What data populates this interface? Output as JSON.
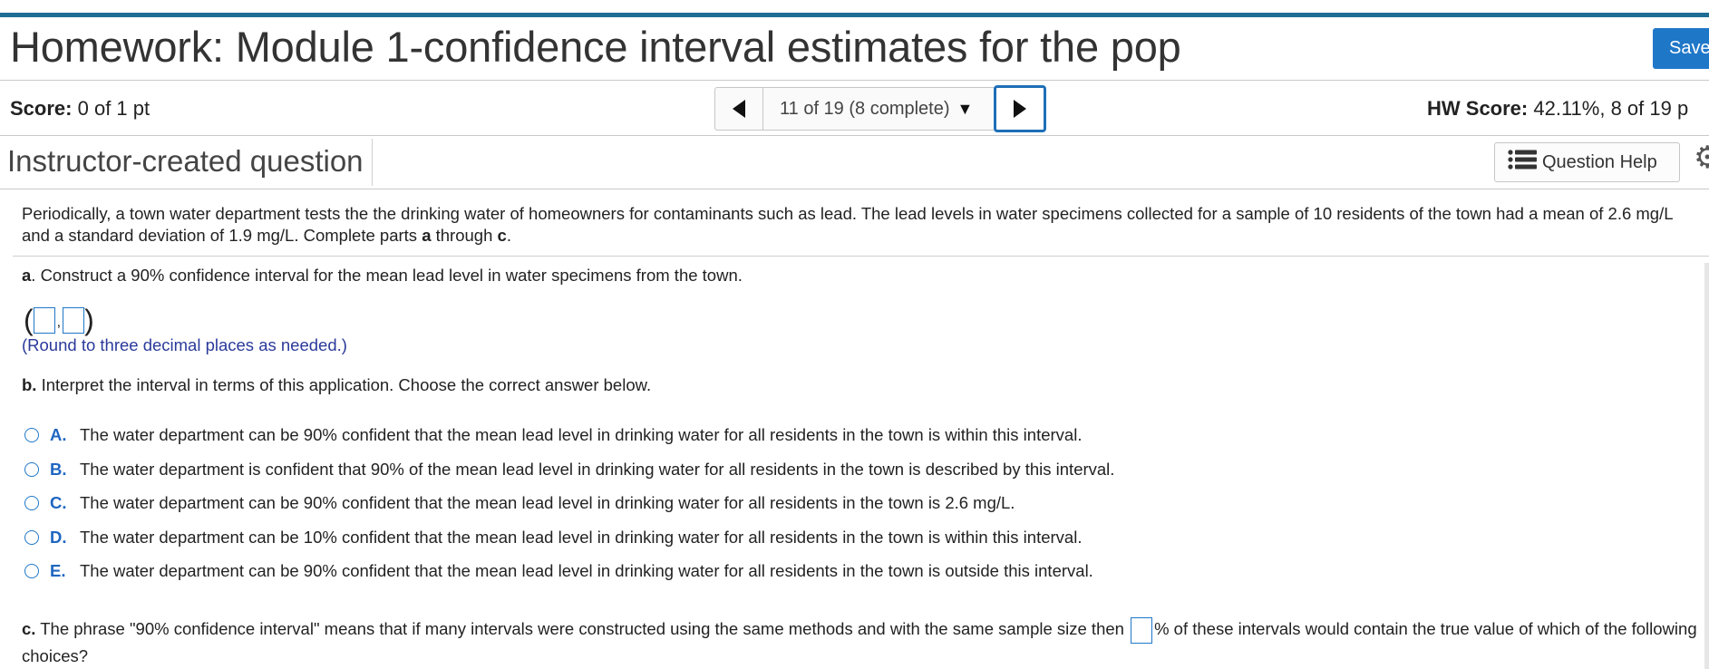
{
  "header": {
    "title": "Homework: Module 1-confidence interval estimates for the pop",
    "save_label": "Save"
  },
  "score_bar": {
    "score_label": "Score:",
    "score_value": "0 of 1 pt",
    "progress_text": "11 of 19 (8 complete)",
    "hw_score_label": "HW Score:",
    "hw_score_value": "42.11%, 8 of 19 p"
  },
  "question_bar": {
    "type_label": "Instructor-created question",
    "help_label": "Question Help"
  },
  "question": {
    "intro_text": "Periodically, a town water department tests the the drinking water of homeowners for contaminants such as lead. The lead levels in water specimens collected for a sample of 10 residents of the town had a mean of 2.6 mg/L and a standard deviation of 1.9 mg/L. Complete parts ",
    "intro_a": "a",
    "intro_through": " through ",
    "intro_c": "c",
    "intro_end": ".",
    "part_a_letter": "a",
    "part_a_text": ". Construct a 90% confidence interval for the mean lead level in water specimens from the town.",
    "open_paren": "(",
    "comma": ",",
    "close_paren": ")",
    "round_note": "(Round to three decimal places as needed.)",
    "part_b_letter": "b.",
    "part_b_text": " Interpret the interval in terms of this application. Choose the correct answer below.",
    "choices": [
      {
        "letter": "A.",
        "text": "The water department can be 90% confident that the mean lead level in drinking water for all residents in the town is within this interval."
      },
      {
        "letter": "B.",
        "text": "The water department is confident that 90% of the mean lead level in drinking water for all residents in the town is described by this interval."
      },
      {
        "letter": "C.",
        "text": "The water department can be 90% confident that the mean lead level in drinking water for all residents in the town is 2.6 mg/L."
      },
      {
        "letter": "D.",
        "text": "The water department can be 10% confident that the mean lead level in drinking water for all residents in the town is within this interval."
      },
      {
        "letter": "E.",
        "text": "The water department can be 90% confident that the mean lead level in drinking water for all residents in the town is outside this interval."
      }
    ],
    "part_c_letter": "c.",
    "part_c_text_1": " The phrase \"90% confidence interval\" means that if many intervals were constructed using the same methods and with the same sample size then ",
    "part_c_text_2": "% of these intervals would contain the true value of which of the following choices?"
  },
  "colors": {
    "accent_bar": "#1f6d94",
    "save_button": "#1f77c8",
    "choice_letter": "#1f66c1",
    "note_text": "#2a3a9a"
  },
  "icons": {
    "prev": "triangle-left-icon",
    "next": "triangle-right-icon",
    "dropdown": "caret-down-icon",
    "help": "list-icon",
    "settings": "gear-icon"
  }
}
